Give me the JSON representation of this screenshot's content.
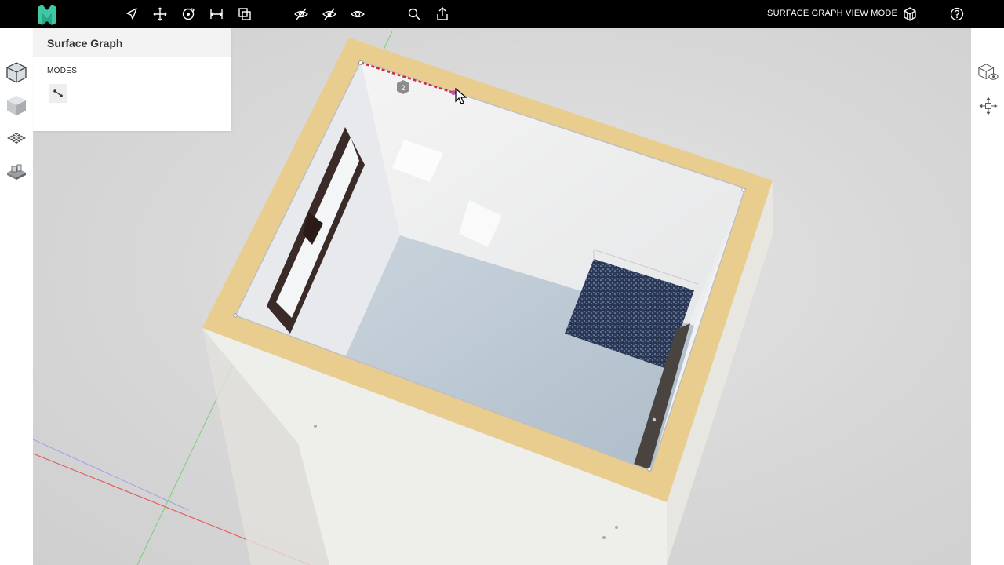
{
  "app": {
    "logo_icon": "matterport-logo-icon"
  },
  "toolbar": {
    "icons": [
      "navigate-icon",
      "move-icon",
      "rotate-icon",
      "measure-icon",
      "transform-icon",
      "hide-icon",
      "hide-all-icon",
      "view-icon",
      "search-icon",
      "share-icon"
    ],
    "mode_label": "SURFACE GRAPH VIEW MODE",
    "mode_icon": "cube-wireframe-icon",
    "help_icon": "help-icon"
  },
  "left_rail": {
    "items": [
      {
        "icon": "cube-outline-icon",
        "active": false
      },
      {
        "icon": "cube-solid-icon",
        "active": false
      },
      {
        "icon": "grid-plane-icon",
        "active": true
      },
      {
        "icon": "objects-icon",
        "active": false
      }
    ]
  },
  "panel": {
    "title": "Surface Graph",
    "section_label": "MODES",
    "mode_buttons": [
      "edge-tool-icon"
    ]
  },
  "right_rail": {
    "items": [
      "cube-visibility-icon",
      "transform-gizmo-icon"
    ]
  },
  "viewport": {
    "edge_label": "2",
    "colors": {
      "frame": "#e6c98a",
      "wall": "#f1f2f2",
      "floor": "#bccad6",
      "rug": "#2f3e5e",
      "axis_x": "#e84a4a",
      "axis_y": "#5ccc5c",
      "axis_z": "#8a8af0",
      "highlight_edge": "#d22b3a"
    }
  }
}
